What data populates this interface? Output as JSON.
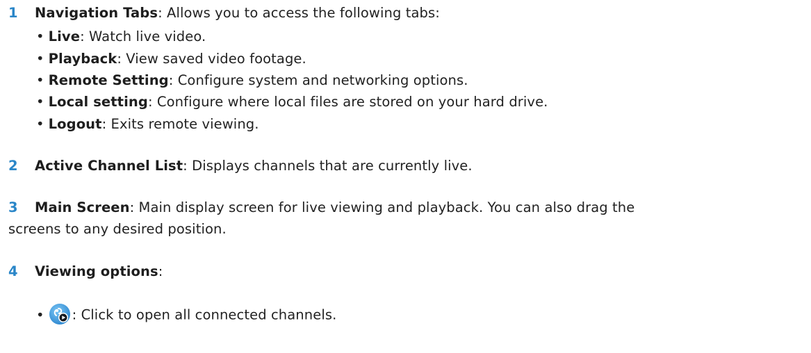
{
  "sections": [
    {
      "number": "1",
      "title": "Navigation Tabs",
      "text": ": Allows you to access the following tabs:",
      "items": [
        {
          "term": "Live",
          "text": ": Watch live video."
        },
        {
          "term": "Playback",
          "text": ": View saved video footage."
        },
        {
          "term": "Remote Setting",
          "text": ": Configure system and networking options."
        },
        {
          "term": "Local setting",
          "text": ": Configure where local files are stored on your hard drive."
        },
        {
          "term": "Logout",
          "text": ": Exits remote viewing."
        }
      ]
    },
    {
      "number": "2",
      "title": "Active Channel List",
      "text": ": Displays channels that are currently live."
    },
    {
      "number": "3",
      "title": "Main Screen",
      "text": ": Main display screen for live viewing and playback. You can also drag the",
      "text_cont": "screens to any desired position."
    },
    {
      "number": "4",
      "title": "Viewing options",
      "text": ":",
      "items": [
        {
          "icon": "open-all-channels-icon",
          "text": ": Click to open all connected channels."
        }
      ]
    }
  ],
  "bullet_char": "•",
  "colors": {
    "number": "#2a86c8",
    "icon_blue": "#3d9fe0"
  }
}
